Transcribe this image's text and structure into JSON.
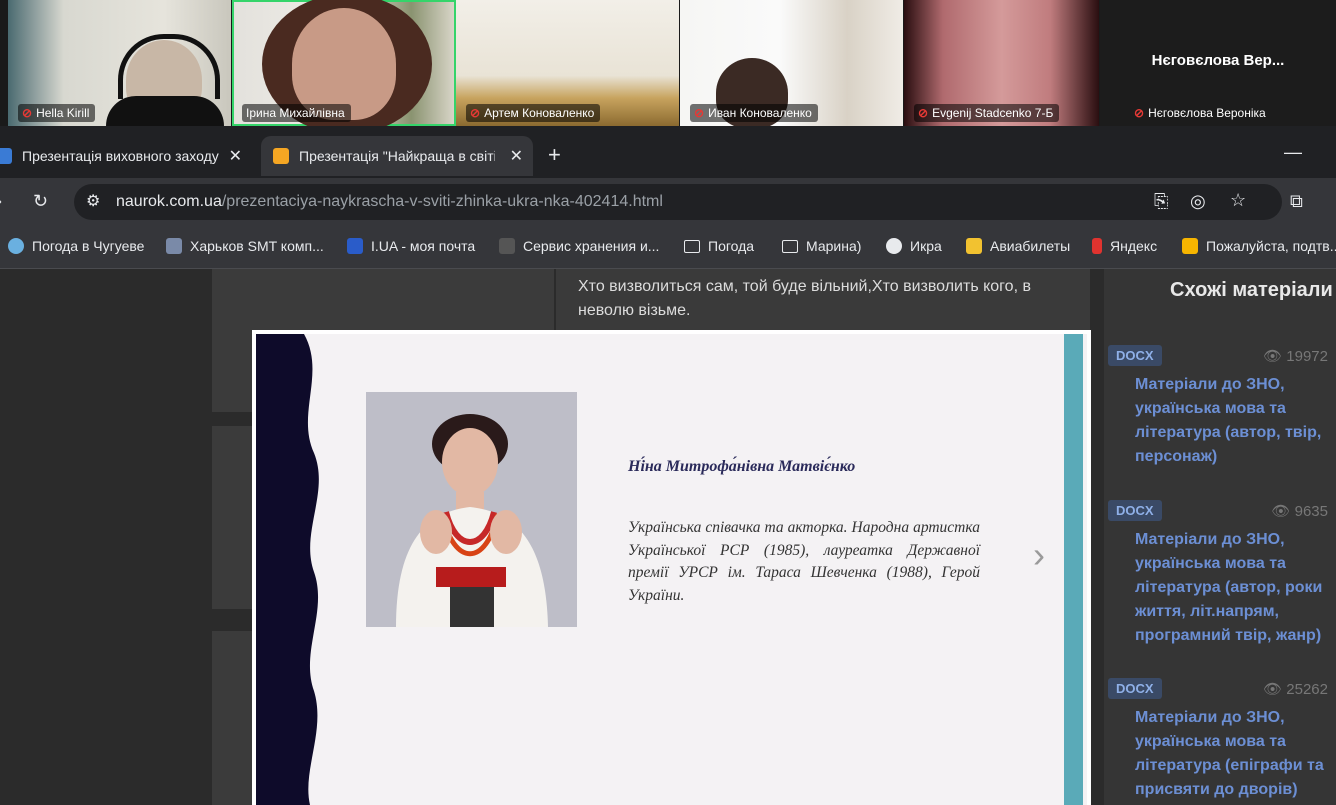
{
  "call": {
    "participants": [
      {
        "name": "Hella Kirill"
      },
      {
        "name": "Ірина Михайлівна"
      },
      {
        "name": "Артем Коноваленко"
      },
      {
        "name": "Иван Коноваленко"
      },
      {
        "name": "Evgenij Stadcenko 7-Б"
      },
      {
        "name": "Нєговєлова Вероніка",
        "display": "Нєговєлова Вер..."
      }
    ]
  },
  "browser": {
    "tabs": [
      {
        "title": "Презентація виховного заходу"
      },
      {
        "title": "Презентація \"Найкраща в світі"
      }
    ],
    "new_tab": "+",
    "minimize": "—",
    "url_host": "naurok.com.ua",
    "url_path": "/prezentaciya-naykrascha-v-sviti-zhinka-ukra-nka-402414.html",
    "bookmarks": [
      {
        "label": "Погода в Чугуеве"
      },
      {
        "label": "Харьков SMT комп..."
      },
      {
        "label": "I.UA - моя почта"
      },
      {
        "label": "Сервис хранения и..."
      },
      {
        "label": "Погода"
      },
      {
        "label": "Марина)"
      },
      {
        "label": "Икра"
      },
      {
        "label": "Авиабилеты"
      },
      {
        "label": "Яндекс"
      },
      {
        "label": "Пожалуйста, подтв..."
      }
    ]
  },
  "page": {
    "quote": "Хто визволиться сам, той буде вільний,Хто визволить кого, в неволю візьме.",
    "sidebar": {
      "title": "Схожі матеріали",
      "items": [
        {
          "badge": "DOCX",
          "views": "19972",
          "title": "Матеріали до ЗНО, українська мова та література (автор, твір, персонаж)"
        },
        {
          "badge": "DOCX",
          "views": "9635",
          "title": "Матеріали до ЗНО, українська мова та література (автор, роки життя, літ.напрям, програмний твір, жанр)"
        },
        {
          "badge": "DOCX",
          "views": "25262",
          "title": "Матеріали до ЗНО, українська мова та література (епіграфи та присвяти до дворів)"
        }
      ]
    }
  },
  "slide": {
    "name": "Ні́на Митрофа́нівна Матвіє́нко",
    "description": "Українська співачка та акторка. Народна артистка Української РСР (1985), лауреатка Державної премії УРСР ім. Тараса Шевченка (1988), Герой України.",
    "next_arrow": "›"
  },
  "colors": {
    "accent_link": "#6c8fd4",
    "active_speaker": "#35d46a",
    "slide_bar": "#5aaab8",
    "slide_wave": "#0e0b2a"
  }
}
